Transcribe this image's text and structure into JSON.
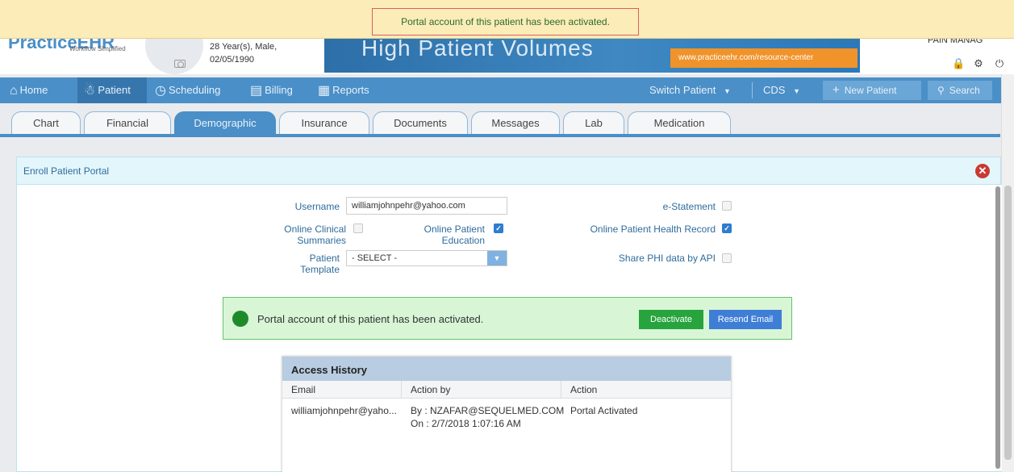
{
  "banner": {
    "message": "Portal account of this patient has been activated."
  },
  "header": {
    "logo_text": "PracticeEHR",
    "logo_sub": "Workflow Simplified",
    "patient_age_sex": "28 Year(s), Male,",
    "patient_dob": "02/05/1990",
    "ad_title": "High Patient Volumes",
    "ad_url": "www.practiceehr.com/resource-center",
    "user_name": "PAIN MANAG"
  },
  "nav": {
    "items": [
      {
        "label": "Home",
        "icon": "home-icon"
      },
      {
        "label": "Patient",
        "icon": "patient-icon"
      },
      {
        "label": "Scheduling",
        "icon": "clock-icon"
      },
      {
        "label": "Billing",
        "icon": "billing-icon"
      },
      {
        "label": "Reports",
        "icon": "calendar-icon"
      }
    ],
    "switch_patient": "Switch Patient",
    "cds": "CDS",
    "new_patient": "New Patient",
    "search": "Search"
  },
  "tabs": [
    "Chart",
    "Financial",
    "Demographic",
    "Insurance",
    "Documents",
    "Messages",
    "Lab",
    "Medication"
  ],
  "panel": {
    "title": "Enroll Patient Portal",
    "username_label": "Username",
    "username_value": "williamjohnpehr@yahoo.com",
    "online_clinical_label_1": "Online Clinical",
    "online_clinical_label_2": "Summaries",
    "online_patient_edu_label_1": "Online Patient",
    "online_patient_edu_label_2": "Education",
    "patient_template_label_1": "Patient",
    "patient_template_label_2": "Template",
    "patient_template_value": "- SELECT -",
    "estatement_label": "e-Statement",
    "online_health_record_label": "Online Patient Health Record",
    "share_phi_label": "Share PHI data by API",
    "checks": {
      "online_clinical": false,
      "online_patient_edu": true,
      "estatement": false,
      "online_health_record": true,
      "share_phi": false
    }
  },
  "status": {
    "message": "Portal account of this patient has been activated.",
    "deactivate": "Deactivate",
    "resend_email": "Resend Email"
  },
  "history": {
    "title": "Access History",
    "columns": [
      "Email",
      "Action by",
      "Action"
    ],
    "rows": [
      {
        "email": "williamjohnpehr@yaho...",
        "action_by_1": "By : NZAFAR@SEQUELMED.COM",
        "action_by_2": "On : 2/7/2018 1:07:16 AM",
        "action": "Portal Activated"
      }
    ]
  }
}
